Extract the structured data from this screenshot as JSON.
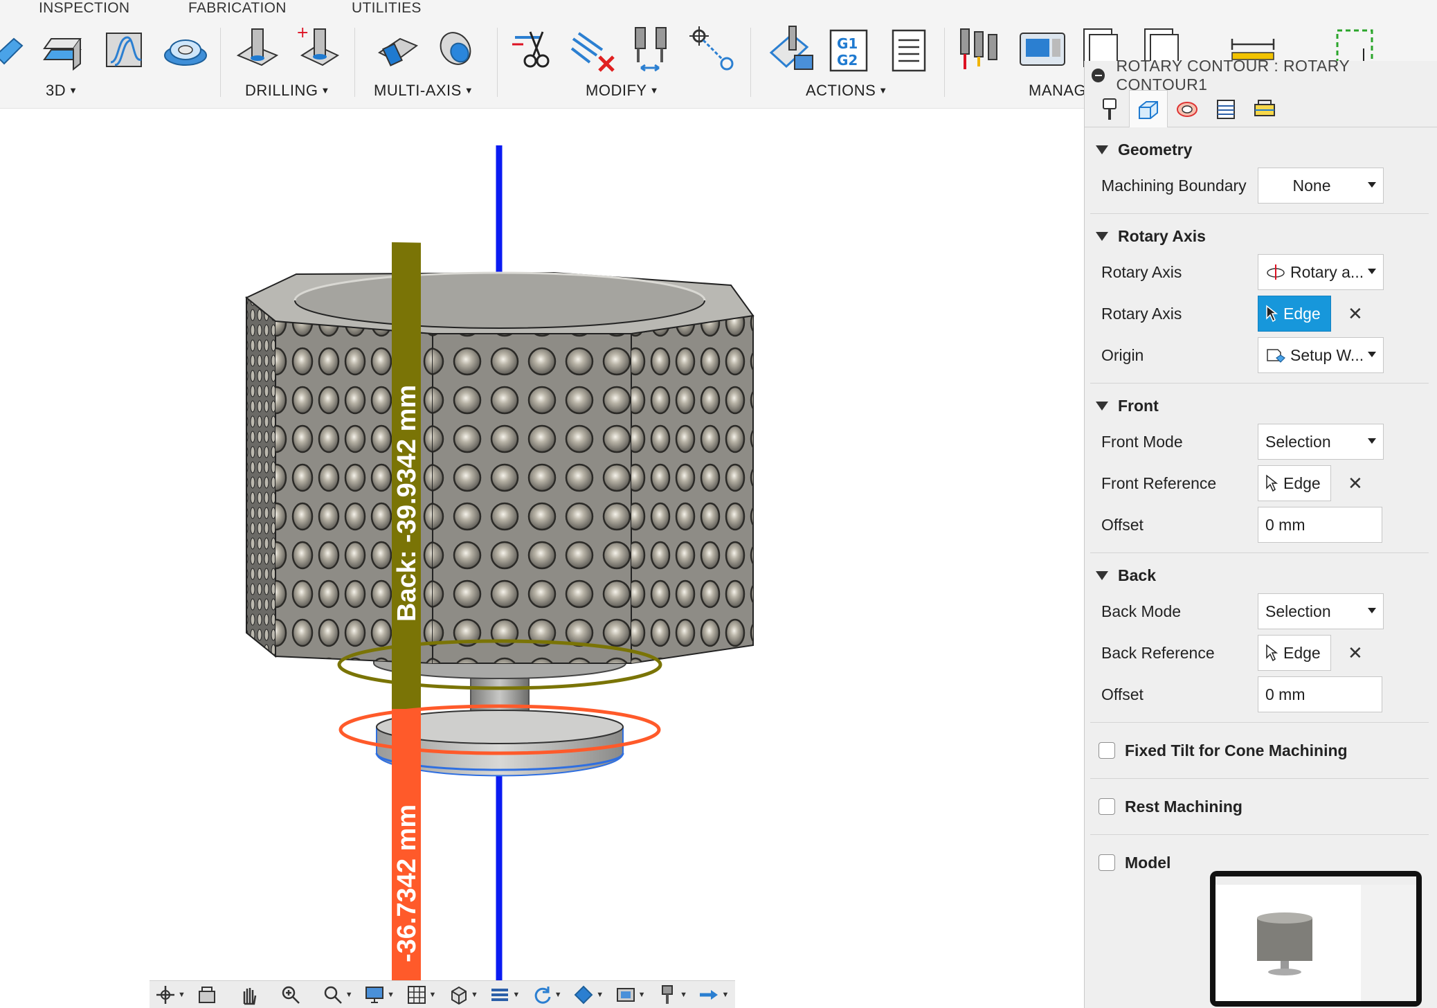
{
  "ribbon": {
    "tabs": [
      "INSPECTION",
      "FABRICATION",
      "UTILITIES"
    ],
    "groups": [
      "3D",
      "DRILLING",
      "MULTI-AXIS",
      "MODIFY",
      "ACTIONS",
      "MANAG"
    ],
    "actions_icon_text": [
      "G1",
      "G2"
    ]
  },
  "viewport": {
    "back_label": "Back: -39.9342 mm",
    "front_label": "-36.7342 mm",
    "colors": {
      "axis": "#0a1bf2",
      "back": "#7a7406",
      "front": "#ff5a2a",
      "body": "#8c8a85"
    }
  },
  "panel": {
    "title": "ROTARY CONTOUR : ROTARY CONTOUR1",
    "tabs": [
      "tool-tab",
      "geometry-tab",
      "heights-tab",
      "passes-tab",
      "linking-tab"
    ],
    "sections": {
      "geometry": {
        "title": "Geometry",
        "machining_boundary_label": "Machining Boundary",
        "machining_boundary_value": "None"
      },
      "rotary_axis": {
        "title": "Rotary Axis",
        "axis_label": "Rotary Axis",
        "axis_value": "Rotary a...",
        "axis_sel_label": "Rotary Axis",
        "axis_sel_value": "Edge",
        "origin_label": "Origin",
        "origin_value": "Setup W..."
      },
      "front": {
        "title": "Front",
        "mode_label": "Front Mode",
        "mode_value": "Selection",
        "ref_label": "Front Reference",
        "ref_value": "Edge",
        "offset_label": "Offset",
        "offset_value": "0 mm"
      },
      "back": {
        "title": "Back",
        "mode_label": "Back Mode",
        "mode_value": "Selection",
        "ref_label": "Back Reference",
        "ref_value": "Edge",
        "offset_label": "Offset",
        "offset_value": "0 mm"
      }
    },
    "checkboxes": {
      "fixed_tilt": "Fixed Tilt for Cone Machining",
      "rest": "Rest Machining",
      "model": "Model"
    },
    "close_glyph": "✕"
  }
}
